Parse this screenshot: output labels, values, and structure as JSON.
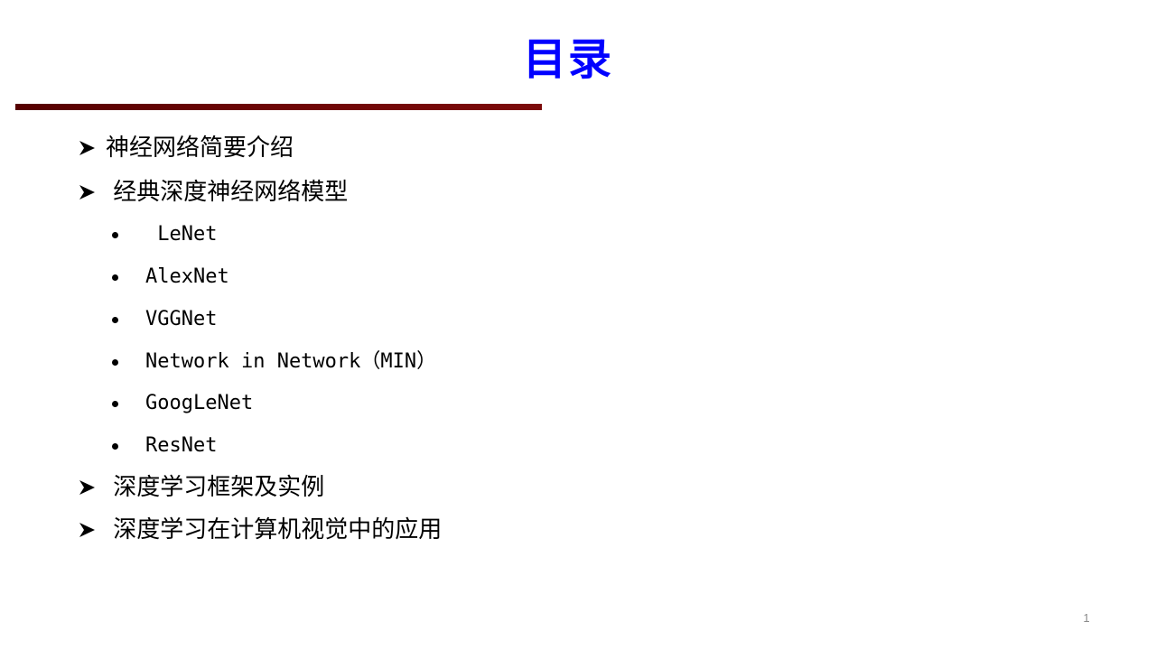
{
  "slide": {
    "title": "目录",
    "title_color": "#0000ff",
    "rule_color": "#6e0606",
    "page_number": "1",
    "outline": [
      {
        "level": 1,
        "bullet": "arrow-icon",
        "label": "神经网络简要介绍"
      },
      {
        "level": 1,
        "bullet": "arrow-icon",
        "label": " 经典深度神经网络模型"
      },
      {
        "level": 2,
        "bullet": "dot-icon",
        "label": " LeNet"
      },
      {
        "level": 2,
        "bullet": "dot-icon",
        "label": "AlexNet"
      },
      {
        "level": 2,
        "bullet": "dot-icon",
        "label": "VGGNet"
      },
      {
        "level": 2,
        "bullet": "dot-icon",
        "label": "Network in Network（MIN）"
      },
      {
        "level": 2,
        "bullet": "dot-icon",
        "label": "GoogLeNet"
      },
      {
        "level": 2,
        "bullet": "dot-icon",
        "label": "ResNet"
      },
      {
        "level": 1,
        "bullet": "arrow-icon",
        "label": " 深度学习框架及实例"
      },
      {
        "level": 1,
        "bullet": "arrow-icon",
        "label": " 深度学习在计算机视觉中的应用"
      }
    ]
  }
}
